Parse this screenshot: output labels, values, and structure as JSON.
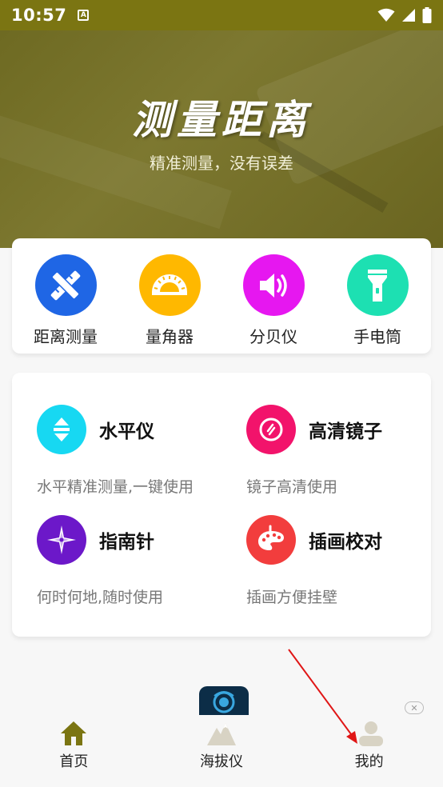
{
  "status_bar": {
    "time": "10:57",
    "notification_letter": "A"
  },
  "hero": {
    "title": "测量距离",
    "subtitle": "精准测量，没有误差"
  },
  "tools": [
    {
      "label": "距离测量",
      "icon": "ruler-cross-icon",
      "color": "#1f66e5"
    },
    {
      "label": "量角器",
      "icon": "protractor-icon",
      "color": "#ffb800"
    },
    {
      "label": "分贝仪",
      "icon": "speaker-icon",
      "color": "#e617f0"
    },
    {
      "label": "手电筒",
      "icon": "flashlight-icon",
      "color": "#1de0b2"
    }
  ],
  "features": [
    {
      "title": "水平仪",
      "desc": "水平精准测量,一键使用",
      "icon": "level-icon",
      "color": "#17d8f2"
    },
    {
      "title": "高清镜子",
      "desc": "镜子高清使用",
      "icon": "mirror-icon",
      "color": "#f2136b"
    },
    {
      "title": "指南针",
      "desc": "何时何地,随时使用",
      "icon": "compass-icon",
      "color": "#6c18c9"
    },
    {
      "title": "插画校对",
      "desc": "插画方便挂壁",
      "icon": "palette-icon",
      "color": "#f23d3d"
    }
  ],
  "bottom_nav": [
    {
      "label": "首页",
      "icon": "home-icon",
      "active": true
    },
    {
      "label": "海拔仪",
      "icon": "mountain-icon",
      "active": false
    },
    {
      "label": "我的",
      "icon": "profile-icon",
      "active": false
    }
  ],
  "colors": {
    "accent": "#7b7512",
    "nav_active": "#7b7512",
    "nav_inactive": "#d8d3c4",
    "annotation": "#e01616"
  }
}
